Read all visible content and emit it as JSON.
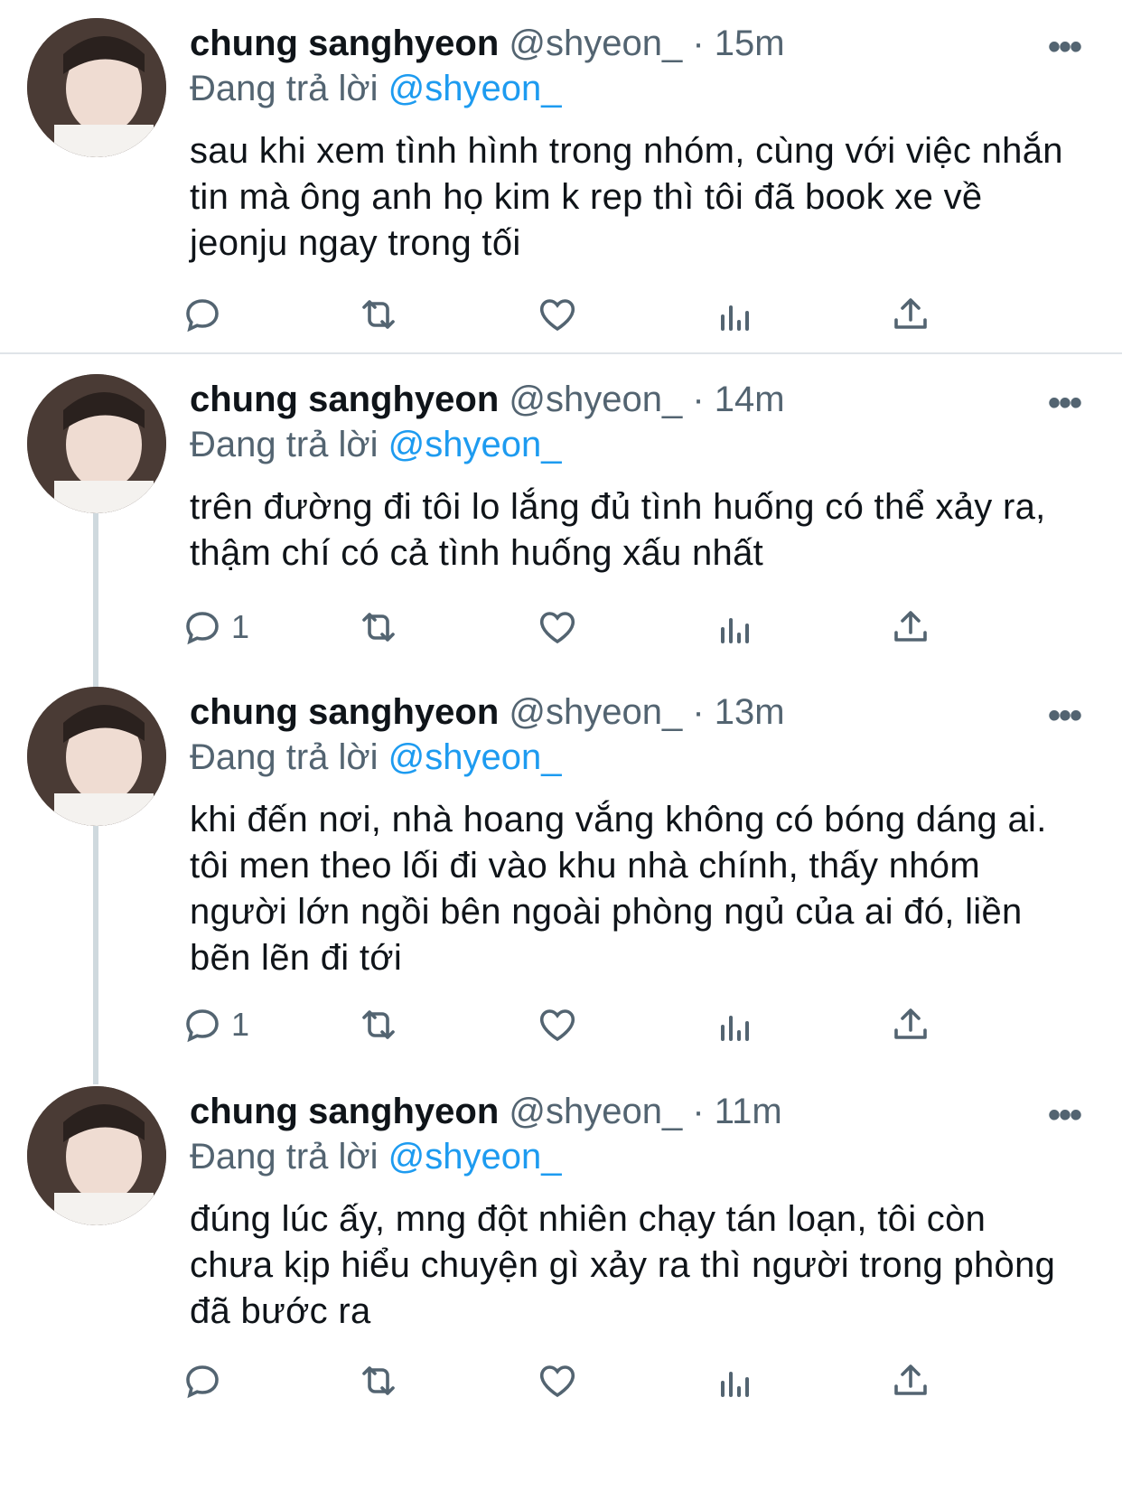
{
  "tweets": [
    {
      "name": "chung sanghyeon",
      "handle": "@shyeon_",
      "dot": "·",
      "time": "15m",
      "replying_prefix": "Đang trả lời",
      "replying_to": "@shyeon_",
      "text": "sau khi xem tình hình trong nhóm, cùng với việc nhắn tin mà ông anh họ kim k rep thì tôi đã book xe về jeonju ngay trong tối",
      "reply_count": ""
    },
    {
      "name": "chung sanghyeon",
      "handle": "@shyeon_",
      "dot": "·",
      "time": "14m",
      "replying_prefix": "Đang trả lời",
      "replying_to": "@shyeon_",
      "text": "trên đường đi tôi lo lắng đủ tình huống có thể xảy ra, thậm chí có cả tình huống xấu nhất",
      "reply_count": "1"
    },
    {
      "name": "chung sanghyeon",
      "handle": "@shyeon_",
      "dot": "·",
      "time": "13m",
      "replying_prefix": "Đang trả lời",
      "replying_to": "@shyeon_",
      "text": "khi đến nơi, nhà hoang vắng không có bóng dáng ai. tôi men theo lối đi vào khu nhà chính, thấy nhóm người lớn ngồi bên ngoài phòng ngủ của ai đó, liền bẽn lẽn đi tới",
      "reply_count": "1"
    },
    {
      "name": "chung sanghyeon",
      "handle": "@shyeon_",
      "dot": "·",
      "time": "11m",
      "replying_prefix": "Đang trả lời",
      "replying_to": "@shyeon_",
      "text": "đúng lúc ấy, mng đột nhiên chạy tán loạn, tôi còn chưa kịp hiểu chuyện gì xảy ra thì người trong phòng đã bước ra",
      "reply_count": ""
    }
  ],
  "more_icon": "more-horizontal-icon",
  "icons": {
    "reply": "reply-icon",
    "retweet": "retweet-icon",
    "like": "heart-icon",
    "views": "views-icon",
    "share": "share-icon"
  },
  "colors": {
    "text": "#0f1419",
    "secondary": "#536471",
    "mention": "#1d9bf0",
    "thread_line": "#cfd9de"
  }
}
